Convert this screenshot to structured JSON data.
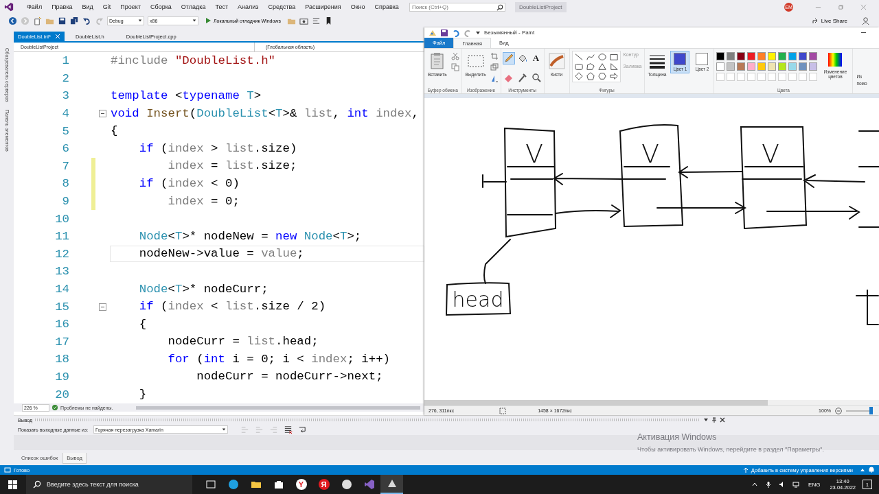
{
  "vs": {
    "menu": [
      "Файл",
      "Правка",
      "Вид",
      "Git",
      "Проект",
      "Сборка",
      "Отладка",
      "Тест",
      "Анализ",
      "Средства",
      "Расширения",
      "Окно",
      "Справка"
    ],
    "search": {
      "placeholder": "Поиск (Ctrl+Q)"
    },
    "project_name": "DoubleListProject",
    "user_initials": "EM",
    "toolbar": {
      "configuration": "Debug",
      "platform": "x86",
      "run_label": "Локальный отладчик Windows"
    },
    "live_share": "Live Share",
    "side_tabs": [
      "Обозреватель серверов",
      "Панель элементов"
    ],
    "tabs": [
      {
        "label": "DoubleList.inl*",
        "selected": true
      },
      {
        "label": "DoubleList.h",
        "selected": false
      },
      {
        "label": "DoubleListProject.cpp",
        "selected": false
      }
    ],
    "nav": {
      "project": "DoubleListProject",
      "scope": "(Глобальная область)"
    },
    "code_lines": [
      {
        "number": "1",
        "changed": false,
        "current": false,
        "fold": false,
        "tokens": [
          {
            "kind": "preprocessor",
            "text": "#include"
          },
          {
            "kind": "string",
            "text": " \"DoubleList.h\""
          }
        ]
      },
      {
        "number": "2",
        "changed": false,
        "current": false,
        "fold": false
      },
      {
        "number": "3",
        "changed": false,
        "current": false,
        "fold": false,
        "tokens": [
          {
            "kind": "keyword",
            "text": "template"
          },
          {
            "kind": "plain",
            "text": " <"
          },
          {
            "kind": "keyword",
            "text": "typename"
          },
          {
            "kind": "type",
            "text": " T"
          },
          {
            "kind": "plain",
            "text": ">"
          }
        ]
      },
      {
        "number": "4",
        "changed": false,
        "current": false,
        "fold": true,
        "tokens": [
          {
            "kind": "keyword",
            "text": "void"
          },
          {
            "kind": "function",
            "text": " Insert"
          },
          {
            "kind": "plain",
            "text": "("
          },
          {
            "kind": "type",
            "text": "DoubleList"
          },
          {
            "kind": "plain",
            "text": "<"
          },
          {
            "kind": "type",
            "text": "T"
          },
          {
            "kind": "plain",
            "text": ">& "
          },
          {
            "kind": "parameter",
            "text": "list"
          },
          {
            "kind": "plain",
            "text": ", "
          },
          {
            "kind": "keyword",
            "text": "int"
          },
          {
            "kind": "parameter",
            "text": " index"
          },
          {
            "kind": "plain",
            "text": ","
          }
        ]
      },
      {
        "number": "5",
        "changed": false,
        "current": false,
        "fold": false,
        "tokens": [
          {
            "kind": "plain",
            "text": "{"
          }
        ]
      },
      {
        "number": "6",
        "changed": false,
        "current": false,
        "fold": false,
        "tokens": [
          {
            "kind": "keyword",
            "text": "    if"
          },
          {
            "kind": "plain",
            "text": " ("
          },
          {
            "kind": "parameter",
            "text": "index"
          },
          {
            "kind": "plain",
            "text": " > "
          },
          {
            "kind": "parameter",
            "text": "list"
          },
          {
            "kind": "plain",
            "text": ".size)"
          }
        ]
      },
      {
        "number": "7",
        "changed": true,
        "current": false,
        "fold": false,
        "tokens": [
          {
            "kind": "parameter",
            "text": "        index"
          },
          {
            "kind": "plain",
            "text": " = "
          },
          {
            "kind": "parameter",
            "text": "list"
          },
          {
            "kind": "plain",
            "text": ".size;"
          }
        ]
      },
      {
        "number": "8",
        "changed": true,
        "current": false,
        "fold": false,
        "tokens": [
          {
            "kind": "keyword",
            "text": "    if"
          },
          {
            "kind": "plain",
            "text": " ("
          },
          {
            "kind": "parameter",
            "text": "index"
          },
          {
            "kind": "plain",
            "text": " < 0)"
          }
        ]
      },
      {
        "number": "9",
        "changed": true,
        "current": false,
        "fold": false,
        "tokens": [
          {
            "kind": "parameter",
            "text": "        index"
          },
          {
            "kind": "plain",
            "text": " = 0;"
          }
        ]
      },
      {
        "number": "10",
        "changed": false,
        "current": false,
        "fold": false
      },
      {
        "number": "11",
        "changed": false,
        "current": false,
        "fold": false,
        "tokens": [
          {
            "kind": "type",
            "text": "    Node"
          },
          {
            "kind": "plain",
            "text": "<"
          },
          {
            "kind": "type",
            "text": "T"
          },
          {
            "kind": "plain",
            "text": ">* nodeNew = "
          },
          {
            "kind": "keyword",
            "text": "new"
          },
          {
            "kind": "type",
            "text": " Node"
          },
          {
            "kind": "plain",
            "text": "<"
          },
          {
            "kind": "type",
            "text": "T"
          },
          {
            "kind": "plain",
            "text": ">;"
          }
        ]
      },
      {
        "number": "12",
        "changed": false,
        "current": true,
        "fold": false,
        "tokens": [
          {
            "kind": "plain",
            "text": "    nodeNew->value = "
          },
          {
            "kind": "parameter",
            "text": "value"
          },
          {
            "kind": "plain",
            "text": ";"
          }
        ]
      },
      {
        "number": "13",
        "changed": false,
        "current": false,
        "fold": false
      },
      {
        "number": "14",
        "changed": false,
        "current": false,
        "fold": false,
        "tokens": [
          {
            "kind": "type",
            "text": "    Node"
          },
          {
            "kind": "plain",
            "text": "<"
          },
          {
            "kind": "type",
            "text": "T"
          },
          {
            "kind": "plain",
            "text": ">* nodeCurr;"
          }
        ]
      },
      {
        "number": "15",
        "changed": false,
        "current": false,
        "fold": true,
        "tokens": [
          {
            "kind": "keyword",
            "text": "    if"
          },
          {
            "kind": "plain",
            "text": " ("
          },
          {
            "kind": "parameter",
            "text": "index"
          },
          {
            "kind": "plain",
            "text": " < "
          },
          {
            "kind": "parameter",
            "text": "list"
          },
          {
            "kind": "plain",
            "text": ".size / 2)"
          }
        ]
      },
      {
        "number": "16",
        "changed": false,
        "current": false,
        "fold": false,
        "tokens": [
          {
            "kind": "plain",
            "text": "    {"
          }
        ]
      },
      {
        "number": "17",
        "changed": false,
        "current": false,
        "fold": false,
        "tokens": [
          {
            "kind": "plain",
            "text": "        nodeCurr = "
          },
          {
            "kind": "parameter",
            "text": "list"
          },
          {
            "kind": "plain",
            "text": ".head;"
          }
        ]
      },
      {
        "number": "18",
        "changed": false,
        "current": false,
        "fold": false,
        "tokens": [
          {
            "kind": "keyword",
            "text": "        for"
          },
          {
            "kind": "plain",
            "text": " ("
          },
          {
            "kind": "keyword",
            "text": "int"
          },
          {
            "kind": "plain",
            "text": " i = 0; i < "
          },
          {
            "kind": "parameter",
            "text": "index"
          },
          {
            "kind": "plain",
            "text": "; i++)"
          }
        ]
      },
      {
        "number": "19",
        "changed": false,
        "current": false,
        "fold": false,
        "tokens": [
          {
            "kind": "plain",
            "text": "            nodeCurr = nodeCurr->next;"
          }
        ]
      },
      {
        "number": "20",
        "changed": false,
        "current": false,
        "fold": false,
        "tokens": [
          {
            "kind": "plain",
            "text": "    }"
          }
        ]
      }
    ],
    "zoom": "226 %",
    "issues": "Проблемы не найдены.",
    "output": {
      "title": "Вывод",
      "source_label": "Показать выходные данные из:",
      "source": "Горячая перезагрузка Xamarin"
    },
    "bottom_tabs": [
      {
        "label": "Список ошибок",
        "selected": false
      },
      {
        "label": "Вывод",
        "selected": true
      }
    ],
    "status": "Готово",
    "vcs": "Добавить в систему управления версиями"
  },
  "paint": {
    "title": "Безымянный - Paint",
    "tabs": [
      {
        "label": "Файл",
        "kind": "file",
        "selected": false
      },
      {
        "label": "Главная",
        "kind": "tab",
        "selected": true
      },
      {
        "label": "Вид",
        "kind": "tab",
        "selected": false
      }
    ],
    "ribbon": {
      "paste": "Вставить",
      "clipboard": "Буфер обмена",
      "select": "Выделить",
      "image": "Изображение",
      "text_tool": "A",
      "tools": "Инструменты",
      "brushes": "Кисти",
      "outline": "Контур",
      "fill": "Заливка",
      "shapes": "Фигуры",
      "size": "Толщина",
      "colors": "Цвета",
      "edit_colors": "Изменение цветов",
      "paint3d": [
        "Из",
        "помо"
      ]
    },
    "color_slots": [
      {
        "label": "Цвет 1",
        "color": "#3f48cc",
        "selected": true
      },
      {
        "label": "Цвет 2",
        "color": "#ffffff",
        "selected": false
      }
    ],
    "palette": [
      {
        "color": "#000000"
      },
      {
        "color": "#7f7f7f"
      },
      {
        "color": "#880015"
      },
      {
        "color": "#ed1c24"
      },
      {
        "color": "#ff7f27"
      },
      {
        "color": "#fff200"
      },
      {
        "color": "#22b14c"
      },
      {
        "color": "#00a2e8"
      },
      {
        "color": "#3f48cc"
      },
      {
        "color": "#a349a4"
      },
      {
        "color": "#ffffff"
      },
      {
        "color": "#c3c3c3"
      },
      {
        "color": "#b97a57"
      },
      {
        "color": "#ffaec9"
      },
      {
        "color": "#ffc90e"
      },
      {
        "color": "#efe4b0"
      },
      {
        "color": "#b5e61d"
      },
      {
        "color": "#99d9ea"
      },
      {
        "color": "#7092be"
      },
      {
        "color": "#c8bfe7"
      }
    ],
    "canvas": {
      "node_values": [
        "V",
        "V",
        "V"
      ],
      "head_label": "head"
    },
    "status": {
      "cursor": "276, 311пкс",
      "size": "1458 × 1672пкс",
      "zoom": "100%"
    },
    "zoom_slider": {
      "level": 0.97
    }
  },
  "activation": {
    "title": "Активация Windows",
    "text": "Чтобы активировать Windows, перейдите в раздел \"Параметры\"."
  },
  "taskbar": {
    "search_placeholder": "Введите здесь текст для поиска",
    "apps": [
      {
        "kind": "taskview",
        "active": false
      },
      {
        "kind": "edge",
        "active": false
      },
      {
        "kind": "folder",
        "active": false
      },
      {
        "kind": "store",
        "active": false
      },
      {
        "kind": "browser",
        "glyph": "Y",
        "active": false
      },
      {
        "kind": "yandex",
        "glyph": "Я",
        "active": false
      },
      {
        "kind": "obs",
        "active": false
      },
      {
        "kind": "vs",
        "active": false
      },
      {
        "kind": "paint",
        "active": true
      }
    ],
    "lang": "ENG",
    "time": "13:40",
    "date": "23.04.2022",
    "notifications": "1"
  }
}
